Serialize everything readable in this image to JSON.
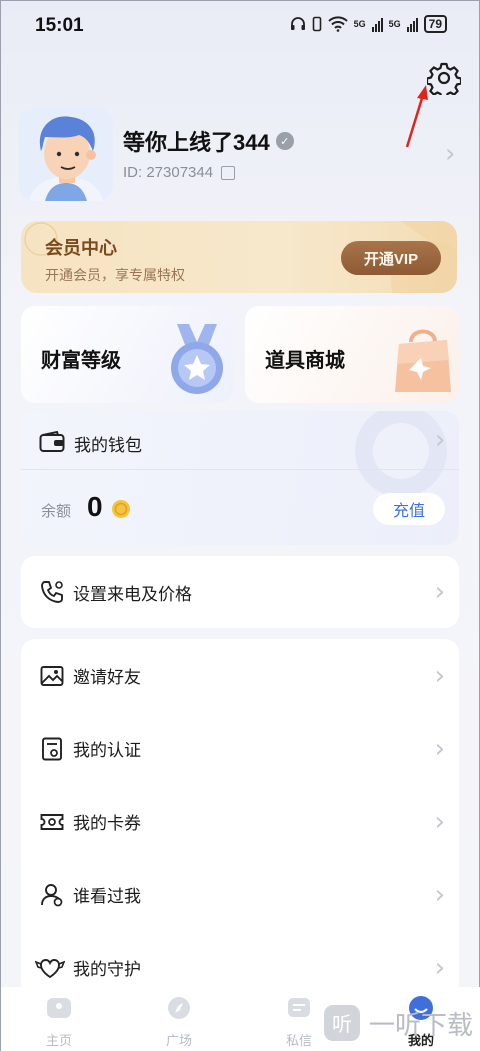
{
  "status_bar": {
    "time": "15:01",
    "network": "5G",
    "battery": "79"
  },
  "profile": {
    "nickname": "等你上线了344",
    "id_text": "ID: 27307344"
  },
  "vip": {
    "title": "会员中心",
    "subtitle": "开通会员，享专属特权",
    "button": "开通VIP"
  },
  "cards": {
    "wealth_label": "财富等级",
    "shop_label": "道具商城"
  },
  "wallet": {
    "title": "我的钱包",
    "balance_label": "余额",
    "balance_value": "0",
    "recharge_label": "充值"
  },
  "call_settings": {
    "label": "设置来电及价格"
  },
  "menu": {
    "items": [
      {
        "label": "邀请好友",
        "icon": "invite-icon"
      },
      {
        "label": "我的认证",
        "icon": "certification-icon"
      },
      {
        "label": "我的卡券",
        "icon": "coupon-icon"
      },
      {
        "label": "谁看过我",
        "icon": "visitors-icon"
      },
      {
        "label": "我的守护",
        "icon": "guardian-icon"
      }
    ]
  },
  "tabbar": {
    "tabs": [
      {
        "label": "主页"
      },
      {
        "label": "广场"
      },
      {
        "label": "私信"
      },
      {
        "label": "我的"
      }
    ],
    "active_index": 3
  },
  "watermark": {
    "text": "一听下载"
  },
  "colors": {
    "accent_blue": "#3f6fd9",
    "vip_brown": "#8d5a34",
    "annotation_red": "#e0241b"
  }
}
